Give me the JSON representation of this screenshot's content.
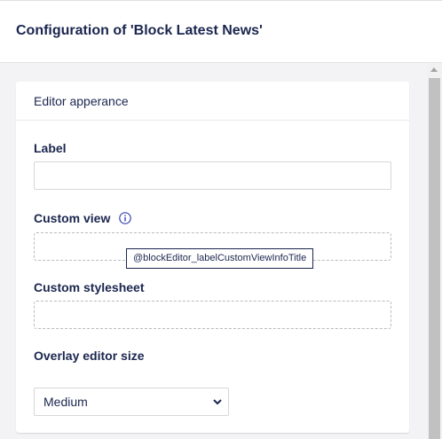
{
  "header": {
    "title": "Configuration of 'Block Latest News'"
  },
  "card": {
    "title": "Editor apperance",
    "fields": {
      "label": {
        "label": "Label",
        "value": ""
      },
      "custom_view": {
        "label": "Custom view",
        "tooltip": "@blockEditor_labelCustomViewInfoTitle",
        "value": ""
      },
      "custom_stylesheet": {
        "label": "Custom stylesheet",
        "value": ""
      },
      "overlay_size": {
        "label": "Overlay editor size",
        "selected": "Medium"
      }
    }
  },
  "icons": {
    "info": "info-icon",
    "chevron": "chevron-down-icon",
    "scroll_up": "scroll-up-arrow-icon"
  },
  "colors": {
    "text": "#1b264f",
    "info_icon": "#3544b1",
    "border": "#d8d7d9"
  }
}
